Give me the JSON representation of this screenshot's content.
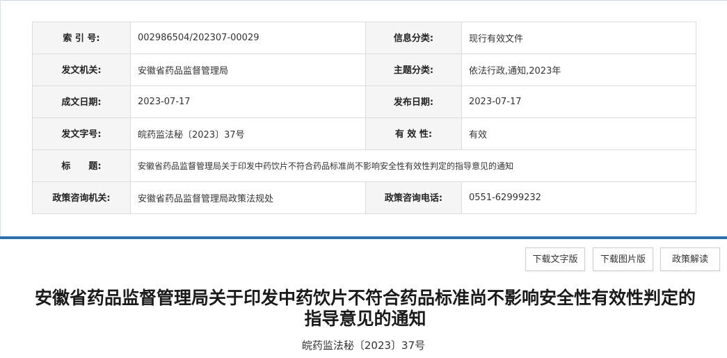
{
  "info": {
    "index_label": "索 引 号:",
    "index_value": "002986504/202307-00029",
    "category_label": "信息分类:",
    "category_value": "现行有效文件",
    "issuer_label": "发文机关:",
    "issuer_value": "安徽省药品监督管理局",
    "topic_label": "主题分类:",
    "topic_value": "依法行政,通知,2023年",
    "created_label": "成文日期:",
    "created_value": "2023-07-17",
    "published_label": "发布日期:",
    "published_value": "2023-07-17",
    "docnum_label": "发文字号:",
    "docnum_value": "皖药监法秘〔2023〕37号",
    "validity_label": "有 效 性:",
    "validity_value": "有效",
    "title_label": "标　　题:",
    "title_value": "安徽省药品监督管理局关于印发中药饮片不符合药品标准尚不影响安全性有效性判定的指导意见的通知",
    "consult_org_label": "政策咨询机关:",
    "consult_org_value": "安徽省药品监督管理局政策法规处",
    "consult_phone_label": "政策咨询电话:",
    "consult_phone_value": "0551-62999232"
  },
  "actions": {
    "download_text": "下载文字版",
    "download_image": "下载图片版",
    "policy_interpretation": "政策解读"
  },
  "document": {
    "title": "安徽省药品监督管理局关于印发中药饮片不符合药品标准尚不影响安全性有效性判定的指导意见的通知",
    "number": "皖药监法秘〔2023〕37号"
  },
  "colors": {
    "divider": "#2f6fad",
    "label_bg": "#f5f5f5",
    "border": "#dcdcdc"
  }
}
